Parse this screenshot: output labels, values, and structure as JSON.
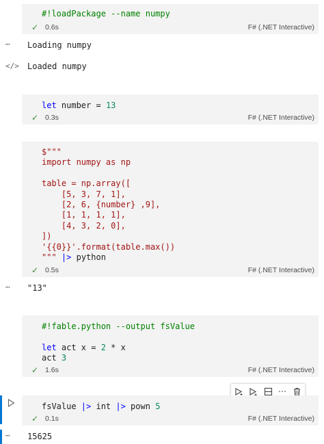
{
  "cells": [
    {
      "status": {
        "time": "0.6s",
        "lang": "F# (.NET Interactive)"
      }
    },
    {
      "status": {
        "time": "0.3s",
        "lang": "F# (.NET Interactive)"
      }
    },
    {
      "status": {
        "time": "0.5s",
        "lang": "F# (.NET Interactive)"
      }
    },
    {
      "status": {
        "time": "1.6s",
        "lang": "F# (.NET Interactive)"
      }
    },
    {
      "status": {
        "time": "0.1s",
        "lang": "F# (.NET Interactive)"
      }
    }
  ],
  "outputs": {
    "loading": "Loading numpy",
    "loaded": "Loaded numpy",
    "result1": "\"13\"",
    "result2": "15625"
  },
  "icons": {
    "gutter_more": "more-icon",
    "gutter_code": "code-icon",
    "run": "run-icon"
  },
  "colors": {
    "success": "#388a34",
    "accent": "#0078d4",
    "cell_bg": "#f3f3f3"
  }
}
